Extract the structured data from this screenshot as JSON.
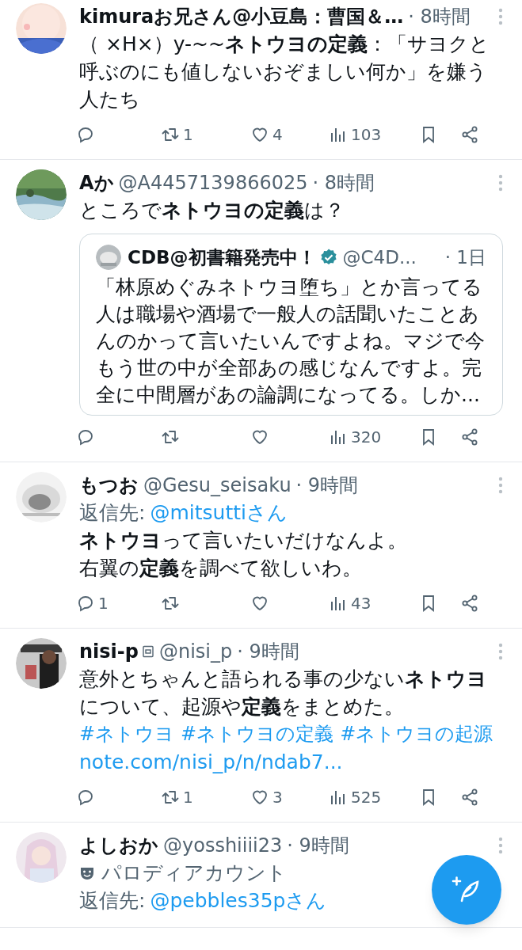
{
  "posts": [
    {
      "name": "kimuraお兄さん@小豆島：曹国＆…",
      "time": "· 8時間",
      "body": "（ ×H×）y-~~**ネトウヨの定義**：「サヨクと呼ぶのにも値しないおぞましい何か」を嫌う人たち",
      "actions": {
        "retweets": "1",
        "likes": "4",
        "views": "103"
      }
    },
    {
      "name": "Aか",
      "handle": "@A4457139866025",
      "time": "· 8時間",
      "body": "ところで**ネトウヨの定義**は？",
      "quote": {
        "name": "CDB@初書籍発売中！",
        "verified": true,
        "handle": "@C4D...",
        "time": "· 1日",
        "body": "「林原めぐみネトウヨ堕ち」とか言ってる人は職場や酒場で一般人の話聞いたことあんのかって言いたいんですよね。マジで今もう世の中が全部あの感じなんですよ。完全に中間層があの論調になってる。しか..."
      },
      "actions": {
        "views": "320"
      }
    },
    {
      "name": "もつお",
      "handle": "@Gesu_seisaku",
      "time": "· 9時間",
      "reply_label": "返信先:",
      "reply_to": "@mitsuttiさん",
      "body": "**ネトウヨ**って言いたいだけなんよ。",
      "body_2": "右翼の**定義**を調べて欲しいわ。",
      "actions": {
        "replies": "1",
        "views": "43"
      }
    },
    {
      "name": "nisi-p",
      "bot_badge": true,
      "handle": "@nisi_p",
      "time": "· 9時間",
      "body": "意外とちゃんと語られる事の少ない**ネトウヨ**について、起源や**定義**をまとめた。",
      "hashtags": [
        "#ネトウヨ",
        "#ネトウヨの定義",
        "#ネトウヨの起源"
      ],
      "link": "note.com/nisi_p/n/ndab7...",
      "actions": {
        "retweets": "1",
        "likes": "3",
        "views": "525"
      }
    },
    {
      "name": "よしおか",
      "handle": "@yosshiiii23",
      "time": "· 9時間",
      "parody": "パロディアカウント",
      "reply_label": "返信先:",
      "reply_to": "@pebbles35pさん"
    }
  ]
}
